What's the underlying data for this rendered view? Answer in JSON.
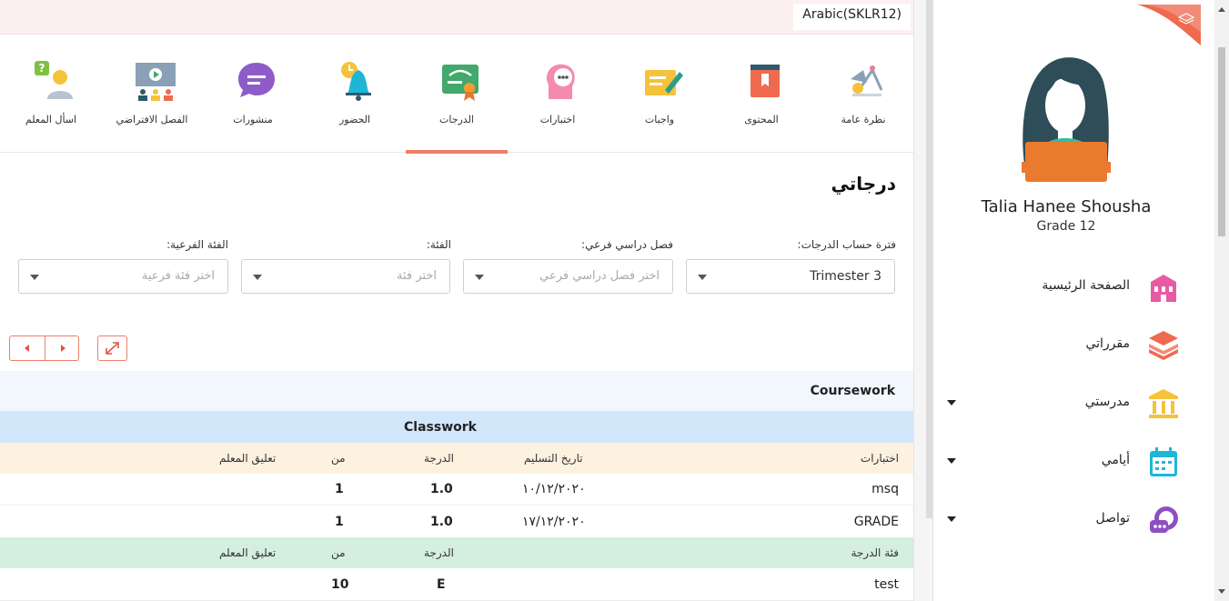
{
  "topbar": {
    "course": "Arabic(SKLR12)"
  },
  "tabs": [
    {
      "label": "نظرة عامة"
    },
    {
      "label": "المحتوى"
    },
    {
      "label": "واجبات"
    },
    {
      "label": "اختبارات"
    },
    {
      "label": "الدرجات",
      "active": true
    },
    {
      "label": "الحضور"
    },
    {
      "label": "منشورات"
    },
    {
      "label": "الفصل الافتراضي"
    },
    {
      "label": "اسأل المعلم"
    }
  ],
  "page": {
    "title": "درجاتي"
  },
  "filters": [
    {
      "label": "فترة حساب الدرجات:",
      "value": "Trimester 3",
      "placeholder": ""
    },
    {
      "label": "فصل دراسي فرعي:",
      "value": "",
      "placeholder": "اختر فصل دراسي فرعي"
    },
    {
      "label": "الفئة:",
      "value": "",
      "placeholder": "اختر فئة"
    },
    {
      "label": "الفئة الفرعية:",
      "value": "",
      "placeholder": "اختر فئة فرعية"
    }
  ],
  "table": {
    "group": "Coursework",
    "subgroup": "Classwork",
    "header1": {
      "name": "اختبارات",
      "date": "تاريخ التسليم",
      "grade": "الدرجة",
      "of": "من",
      "comment": "تعليق المعلم"
    },
    "rows1": [
      {
        "name": "msq",
        "date": "١٠/١٢/٢٠٢٠",
        "grade": "1.0",
        "of": "1"
      },
      {
        "name": "GRADE",
        "date": "١٧/١٢/٢٠٢٠",
        "grade": "1.0",
        "of": "1"
      }
    ],
    "header2": {
      "name": "فئة الدرجة",
      "grade": "الدرجة",
      "of": "من",
      "comment": "تعليق المعلم"
    },
    "rows2": [
      {
        "name": "test",
        "grade": "E",
        "of": "10"
      }
    ]
  },
  "sidebar": {
    "student_name": "Talia Hanee Shousha",
    "grade": "Grade 12",
    "nav": [
      {
        "label": "الصفحة الرئيسية",
        "icon": "school-building-icon",
        "color": "#e95aa4",
        "dropdown": false
      },
      {
        "label": "مقرراتي",
        "icon": "books-stack-icon",
        "color": "#ef6a4f",
        "dropdown": false
      },
      {
        "label": "مدرستي",
        "icon": "institution-icon",
        "color": "#f5c23b",
        "dropdown": true
      },
      {
        "label": "أيامي",
        "icon": "calendar-icon",
        "color": "#1fb6d6",
        "dropdown": true
      },
      {
        "label": "تواصل",
        "icon": "chat-bubbles-icon",
        "color": "#8e4fc4",
        "dropdown": true
      }
    ]
  },
  "colors": {
    "accent": "#f07d6b",
    "coursework_bg": "#f1f7fd",
    "classwork_bg": "#d3e7fb",
    "header_orange": "#fdf1e0",
    "header_green": "#d4eedf"
  }
}
